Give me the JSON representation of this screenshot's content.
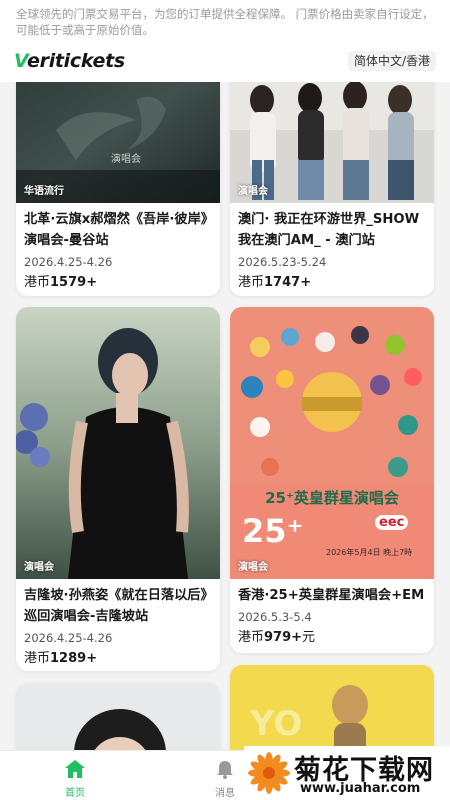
{
  "header": {
    "notice": "全球领先的门票交易平台，为您的订单提供全程保障。 门票价格由卖家自行设定，可能低于或高于原始价值。",
    "logo_v": "V",
    "logo_rest": "eritickets",
    "language": "简体中文/香港"
  },
  "cards": [
    {
      "badge": "华语流行",
      "poster_text": "演唱会",
      "title": "北革·云旗x郝熠然《吾岸·彼岸》演唱会-曼谷站",
      "date": "2026.4.25-4.26",
      "currency": "港币",
      "price": "1579+",
      "suffix": ""
    },
    {
      "badge": "演唱会",
      "title": "澳门· 我正在环游世界_SHOW我在澳门AM_ - 澳门站",
      "date": "2026.5.23-5.24",
      "currency": "港币",
      "price": "1747+",
      "suffix": ""
    },
    {
      "badge": "演唱会",
      "title": "吉隆坡·孙燕姿《就在日落以后》巡回演唱会-吉隆坡站",
      "date": "2026.4.25-4.26",
      "currency": "港币",
      "price": "1289+",
      "suffix": ""
    },
    {
      "badge": "演唱会",
      "poster_title": "25⁺英皇群星演唱会",
      "poster_big": "25⁺",
      "poster_brand": "eec",
      "poster_date": "2026年5月4日 晚上7時",
      "title": "香港·25+英皇群星演唱会+EM",
      "date": "2026.5.3-5.4",
      "currency": "港币",
      "price": "979+",
      "suffix": "元"
    }
  ],
  "nav": {
    "home": "首页",
    "messages": "消息"
  },
  "watermark": {
    "main": "菊花下载网",
    "url": "www.juahar.com"
  },
  "colors": {
    "brand": "#1fbf60",
    "card_bg": "#ffffff",
    "page_bg": "#f3f3f3"
  }
}
